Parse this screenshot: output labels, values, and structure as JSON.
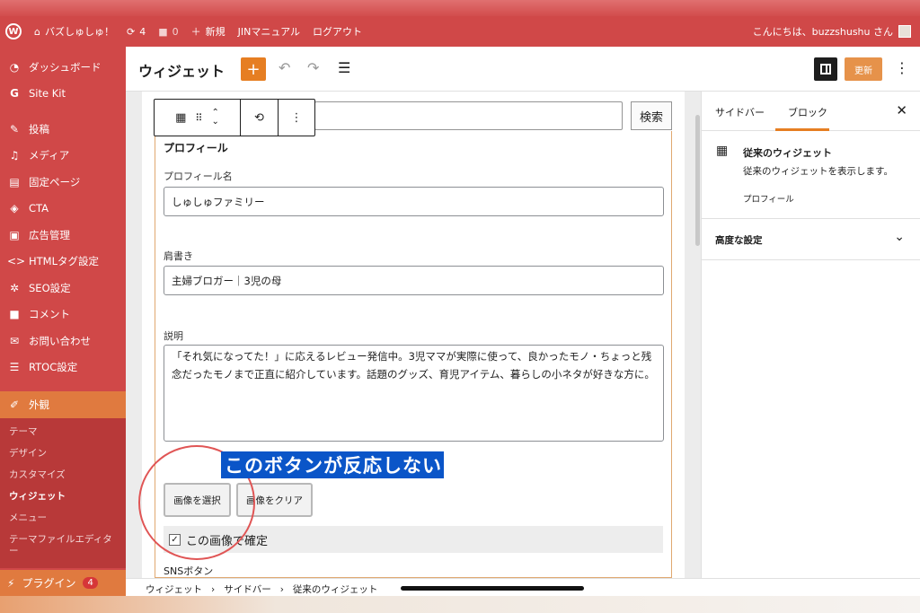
{
  "adminbar": {
    "site_name": "バズしゅしゅ！",
    "updates_count": "4",
    "comments_count": "0",
    "new_label": "新規",
    "jin_manual": "JINマニュアル",
    "logout": "ログアウト",
    "greeting": "こんにちは、buzzshushu さん"
  },
  "sidebar": {
    "items": [
      {
        "label": "ダッシュボード",
        "icon": "speedometer-icon"
      },
      {
        "label": "Site Kit",
        "icon": "g-icon"
      },
      {
        "label": "投稿",
        "icon": "pin-icon"
      },
      {
        "label": "メディア",
        "icon": "media-icon"
      },
      {
        "label": "固定ページ",
        "icon": "page-icon"
      },
      {
        "label": "CTA",
        "icon": "tag-icon"
      },
      {
        "label": "広告管理",
        "icon": "ad-icon"
      },
      {
        "label": "HTMLタグ設定",
        "icon": "code-icon"
      },
      {
        "label": "SEO設定",
        "icon": "gear-icon"
      },
      {
        "label": "コメント",
        "icon": "comment-icon"
      },
      {
        "label": "お問い合わせ",
        "icon": "mail-icon"
      },
      {
        "label": "RTOC設定",
        "icon": "list-icon"
      }
    ],
    "current": {
      "label": "外観",
      "icon": "brush-icon"
    },
    "submenu": [
      "テーマ",
      "デザイン",
      "カスタマイズ",
      "ウィジェット",
      "メニュー",
      "テーマファイルエディター"
    ],
    "plugins": {
      "label": "プラグイン",
      "count": "4"
    }
  },
  "header": {
    "title": "ウィジェット",
    "update_label": "更新"
  },
  "search": {
    "button_label": "検索"
  },
  "widget": {
    "title": "プロフィール",
    "name_label": "プロフィール名",
    "name_value": "しゅしゅファミリー",
    "role_label": "肩書き",
    "role_value": "主婦ブロガー｜3児の母",
    "desc_label": "説明",
    "desc_value": "「それ気になってた！」に応えるレビュー発信中。3児ママが実際に使って、良かったモノ・ちょっと残念だったモノまで正直に紹介しています。話題のグッズ、育児アイテム、暮らしの小ネタが好きな方に。",
    "select_image": "画像を選択",
    "clear_image": "画像をクリア",
    "confirm_label": "この画像で確定",
    "sns_label": "SNSボタン"
  },
  "annotation": "このボタンが反応しない",
  "right_panel": {
    "tab_sidebar": "サイドバー",
    "tab_block": "ブロック",
    "block_name": "従来のウィジェット",
    "block_desc": "従来のウィジェットを表示します。",
    "block_sub": "プロフィール",
    "advanced": "高度な設定"
  },
  "breadcrumb": [
    "ウィジェット",
    "サイドバー",
    "従来のウィジェット"
  ]
}
